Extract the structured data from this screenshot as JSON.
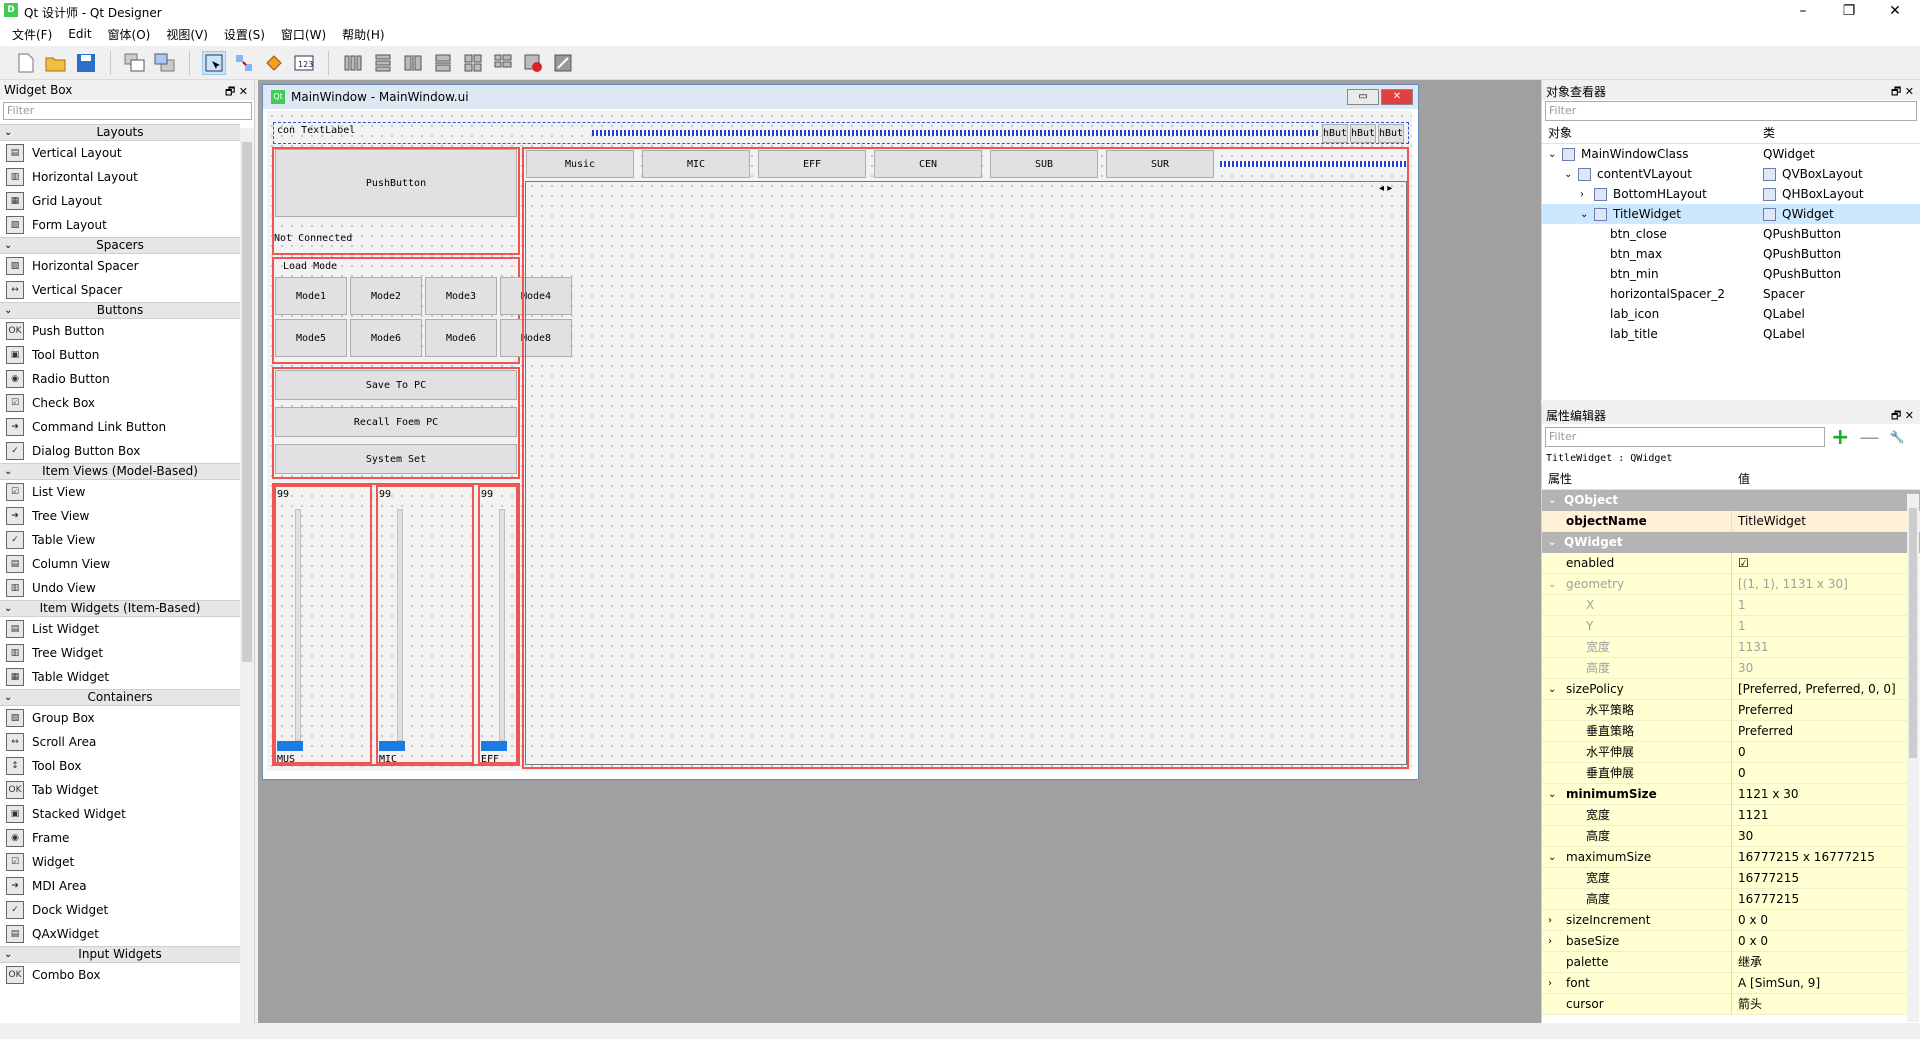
{
  "app": {
    "icon": "D",
    "title": "Qt 设计师 - Qt Designer"
  },
  "menu": [
    "文件(F)",
    "Edit",
    "窗体(O)",
    "视图(V)",
    "设置(S)",
    "窗口(W)",
    "帮助(H)"
  ],
  "widget_box": {
    "title": "Widget Box",
    "filter_placeholder": "Filter",
    "groups": [
      {
        "name": "Layouts",
        "items": [
          "Vertical Layout",
          "Horizontal Layout",
          "Grid Layout",
          "Form Layout"
        ]
      },
      {
        "name": "Spacers",
        "items": [
          "Horizontal Spacer",
          "Vertical Spacer"
        ]
      },
      {
        "name": "Buttons",
        "items": [
          "Push Button",
          "Tool Button",
          "Radio Button",
          "Check Box",
          "Command Link Button",
          "Dialog Button Box"
        ]
      },
      {
        "name": "Item Views (Model-Based)",
        "items": [
          "List View",
          "Tree View",
          "Table View",
          "Column View",
          "Undo View"
        ]
      },
      {
        "name": "Item Widgets (Item-Based)",
        "items": [
          "List Widget",
          "Tree Widget",
          "Table Widget"
        ]
      },
      {
        "name": "Containers",
        "items": [
          "Group Box",
          "Scroll Area",
          "Tool Box",
          "Tab Widget",
          "Stacked Widget",
          "Frame",
          "Widget",
          "MDI Area",
          "Dock Widget",
          "QAxWidget"
        ]
      },
      {
        "name": "Input Widgets",
        "items": [
          "Combo Box"
        ]
      }
    ]
  },
  "form_window": {
    "title": "MainWindow - MainWindow.ui",
    "icon": "Qt",
    "title_label": "con TextLabel",
    "hbuttons": [
      "hBut",
      "hBut",
      "hBut"
    ],
    "push_button": "PushButton",
    "status": "Not Connected",
    "load_mode": "Load Mode",
    "modes": [
      "Mode1",
      "Mode2",
      "Mode3",
      "Mode4",
      "Mode5",
      "Mode6",
      "Mode6",
      "Mode8"
    ],
    "actions": [
      "Save To PC",
      "Recall Foem PC",
      "System Set"
    ],
    "sliders": [
      {
        "value": "99",
        "label": "MUS"
      },
      {
        "value": "99",
        "label": "MIC"
      },
      {
        "value": "99",
        "label": "EFF"
      }
    ],
    "tabs": [
      "Music",
      "MIC",
      "EFF",
      "CEN",
      "SUB",
      "SUR"
    ]
  },
  "object_inspector": {
    "title": "对象查看器",
    "filter_placeholder": "Filter",
    "col_object": "对象",
    "col_class": "类",
    "rows": [
      {
        "name": "MainWindowClass",
        "cls": "QWidget",
        "indent": 0,
        "arrow": "v"
      },
      {
        "name": "contentVLayout",
        "cls": "QVBoxLayout",
        "indent": 1,
        "arrow": "v"
      },
      {
        "name": "BottomHLayout",
        "cls": "QHBoxLayout",
        "indent": 2,
        "arrow": ">"
      },
      {
        "name": "TitleWidget",
        "cls": "QWidget",
        "indent": 2,
        "arrow": "v",
        "selected": true
      },
      {
        "name": "btn_close",
        "cls": "QPushButton",
        "indent": 3,
        "arrow": ""
      },
      {
        "name": "btn_max",
        "cls": "QPushButton",
        "indent": 3,
        "arrow": ""
      },
      {
        "name": "btn_min",
        "cls": "QPushButton",
        "indent": 3,
        "arrow": ""
      },
      {
        "name": "horizontalSpacer_2",
        "cls": "Spacer",
        "indent": 3,
        "arrow": ""
      },
      {
        "name": "lab_icon",
        "cls": "QLabel",
        "indent": 3,
        "arrow": ""
      },
      {
        "name": "lab_title",
        "cls": "QLabel",
        "indent": 3,
        "arrow": ""
      }
    ]
  },
  "property_editor": {
    "title": "属性编辑器",
    "filter_placeholder": "Filter",
    "context": "TitleWidget : QWidget",
    "col_prop": "属性",
    "col_value": "值",
    "rows": [
      {
        "t": "grp",
        "n": "QObject"
      },
      {
        "t": "bold",
        "n": "objectName",
        "v": "TitleWidget"
      },
      {
        "t": "grp",
        "n": "QWidget"
      },
      {
        "t": "y",
        "n": "enabled",
        "v": "☑"
      },
      {
        "t": "dis",
        "n": "geometry",
        "v": "[(1, 1), 1131 x 30]",
        "arrow": "v"
      },
      {
        "t": "dissub",
        "n": "X",
        "v": "1"
      },
      {
        "t": "dissub",
        "n": "Y",
        "v": "1"
      },
      {
        "t": "dissub",
        "n": "宽度",
        "v": "1131"
      },
      {
        "t": "dissub",
        "n": "高度",
        "v": "30"
      },
      {
        "t": "y",
        "n": "sizePolicy",
        "v": "[Preferred, Preferred, 0, 0]",
        "arrow": "v"
      },
      {
        "t": "ysub",
        "n": "水平策略",
        "v": "Preferred"
      },
      {
        "t": "ysub",
        "n": "垂直策略",
        "v": "Preferred"
      },
      {
        "t": "ysub",
        "n": "水平伸展",
        "v": "0"
      },
      {
        "t": "ysub",
        "n": "垂直伸展",
        "v": "0"
      },
      {
        "t": "ybold",
        "n": "minimumSize",
        "v": "1121 x 30",
        "arrow": "v"
      },
      {
        "t": "ysub",
        "n": "宽度",
        "v": "1121"
      },
      {
        "t": "ysub",
        "n": "高度",
        "v": "30"
      },
      {
        "t": "y",
        "n": "maximumSize",
        "v": "16777215 x 16777215",
        "arrow": "v"
      },
      {
        "t": "ysub",
        "n": "宽度",
        "v": "16777215"
      },
      {
        "t": "ysub",
        "n": "高度",
        "v": "16777215"
      },
      {
        "t": "y",
        "n": "sizeIncrement",
        "v": "0 x 0",
        "arrow": ">"
      },
      {
        "t": "y",
        "n": "baseSize",
        "v": "0 x 0",
        "arrow": ">"
      },
      {
        "t": "y",
        "n": "palette",
        "v": "继承"
      },
      {
        "t": "y",
        "n": "font",
        "v": "A  [SimSun, 9]",
        "arrow": ">"
      },
      {
        "t": "y",
        "n": "cursor",
        "v": "箭头"
      }
    ]
  }
}
